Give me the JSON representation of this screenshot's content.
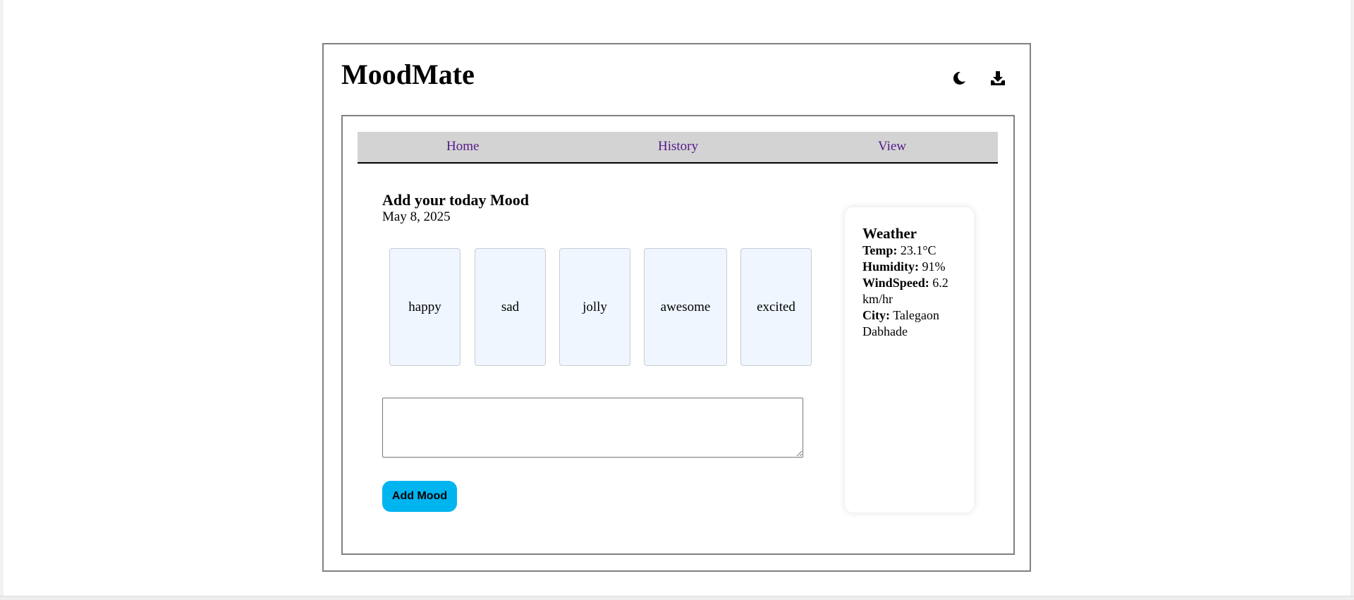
{
  "app": {
    "title": "MoodMate",
    "icons": [
      "moon-icon",
      "download-icon"
    ]
  },
  "nav": {
    "home": "Home",
    "history": "History",
    "view": "View",
    "link_color": "#551a8b",
    "background_color": "#d3d3d3"
  },
  "mood": {
    "heading": "Add your today Mood",
    "date": "May 8, 2025",
    "options": [
      "happy",
      "sad",
      "jolly",
      "awesome",
      "excited"
    ],
    "note_value": "",
    "add_button_label": "Add Mood",
    "button_color": "#00b4f0",
    "card_color": "#eff6ff"
  },
  "weather": {
    "title": "Weather",
    "temp_label": "Temp:",
    "temp_value": "23.1°C",
    "humidity_label": "Humidity:",
    "humidity_value": "91%",
    "windspeed_label": "WindSpeed:",
    "windspeed_value": "6.2 km/hr",
    "city_label": "City:",
    "city_value": "Talegaon Dabhade"
  }
}
